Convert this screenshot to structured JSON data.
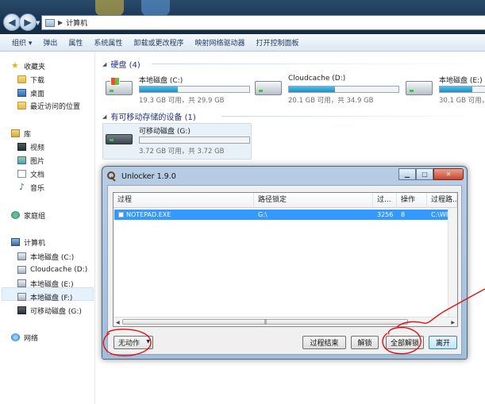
{
  "window": {
    "address_path": "计算机"
  },
  "toolbar": {
    "items": [
      "组织 ▾",
      "弹出",
      "属性",
      "系统属性",
      "卸载或更改程序",
      "映射网络驱动器",
      "打开控制面板"
    ]
  },
  "navigation": {
    "favorites": {
      "label": "收藏夹",
      "items": [
        "下载",
        "桌面",
        "最近访问的位置"
      ]
    },
    "libraries": {
      "label": "库",
      "items": [
        "视频",
        "图片",
        "文档",
        "音乐"
      ]
    },
    "homegroup": {
      "label": "家庭组"
    },
    "computer": {
      "label": "计算机",
      "items": [
        "本地磁盘 (C:)",
        "Cloudcache (D:)",
        "本地磁盘 (E:)",
        "本地磁盘 (F:)",
        "可移动磁盘 (G:)"
      ]
    },
    "network": {
      "label": "网络"
    }
  },
  "content": {
    "hard_disks": {
      "title": "硬盘 (4)",
      "drives": [
        {
          "name": "本地磁盘 (C:)",
          "info": "19.3 GB 可用，共 29.9 GB",
          "used_fraction": 0.35
        },
        {
          "name": "Cloudcache (D:)",
          "info": "20.1 GB 可用，共 34.9 GB",
          "used_fraction": 0.42
        },
        {
          "name": "本地磁盘 (E:)",
          "info": "30.1 GB 可用，共",
          "used_fraction": 0.3
        }
      ]
    },
    "removable": {
      "title": "有可移动存储的设备 (1)",
      "drives": [
        {
          "name": "可移动磁盘 (G:)",
          "info": "3.72 GB 可用，共 3.72 GB",
          "used_fraction": 0.0
        }
      ]
    }
  },
  "unlocker": {
    "title": "Unlocker 1.9.0",
    "columns": [
      "过程",
      "路径锁定",
      "过...",
      "操作",
      "过程路..."
    ],
    "rows": [
      {
        "process": "NOTEPAD.EXE",
        "path": "G:\\",
        "pid": "3256",
        "op": "8",
        "proc_path": "C:\\WIN"
      }
    ],
    "action_select": "无动作",
    "buttons": {
      "kill_process": "过程结束",
      "unlock": "解锁",
      "unlock_all": "全部解锁",
      "quit": "离开"
    }
  },
  "colors": {
    "selection": "#3399ff",
    "annotation": "#e01010",
    "drive_fill": "#26a0da"
  }
}
